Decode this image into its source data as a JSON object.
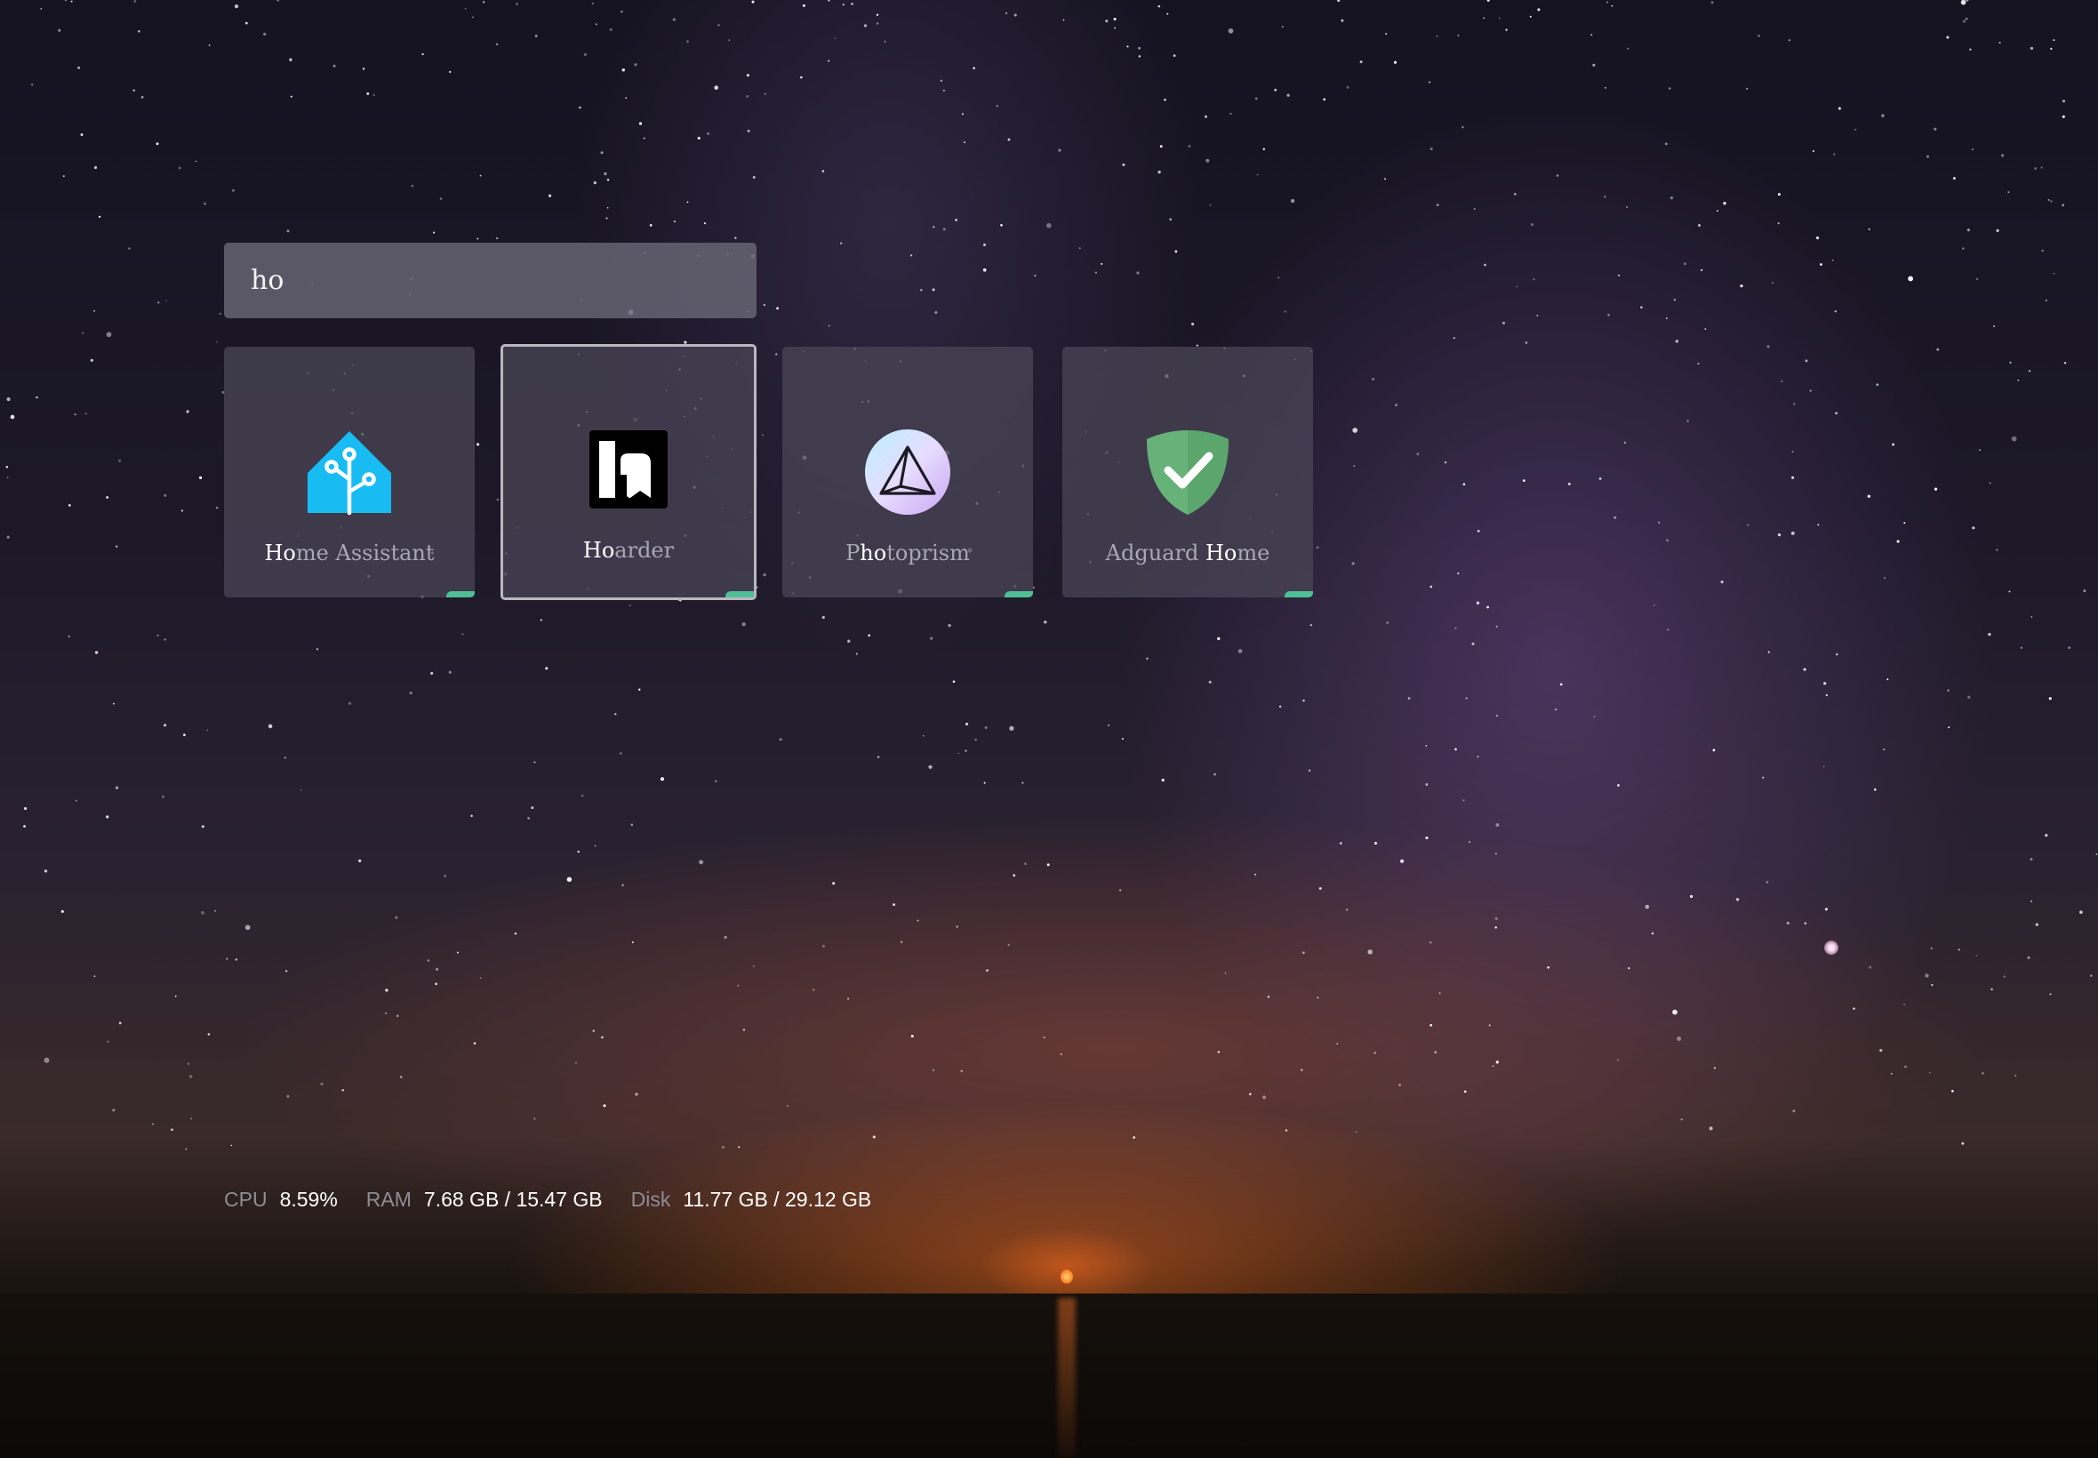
{
  "search": {
    "value": "ho"
  },
  "apps": [
    {
      "name_highlight": "Ho",
      "name_rest": "me Assistant",
      "icon": "home-assistant-icon",
      "color": "#18bcf2",
      "status_color": "#4fbf95"
    },
    {
      "name_highlight": "Ho",
      "name_rest": "arder",
      "icon": "hoarder-icon",
      "color": "#000000",
      "status_color": "#4fbf95",
      "selected": true
    },
    {
      "name_prefix": "P",
      "name_highlight": "ho",
      "name_rest": "toprism",
      "icon": "photoprism-icon",
      "color": "#d9c2f5",
      "status_color": "#4fbf95"
    },
    {
      "name_prefix": "Adguard ",
      "name_highlight": "Ho",
      "name_rest": "me",
      "icon": "adguard-shield-icon",
      "color": "#67b279",
      "status_color": "#4fbf95"
    }
  ],
  "stats": {
    "cpu_label": "CPU",
    "cpu_value": "8.59%",
    "ram_label": "RAM",
    "ram_value": "7.68 GB / 15.47 GB",
    "disk_label": "Disk",
    "disk_value": "11.77 GB / 29.12 GB"
  }
}
